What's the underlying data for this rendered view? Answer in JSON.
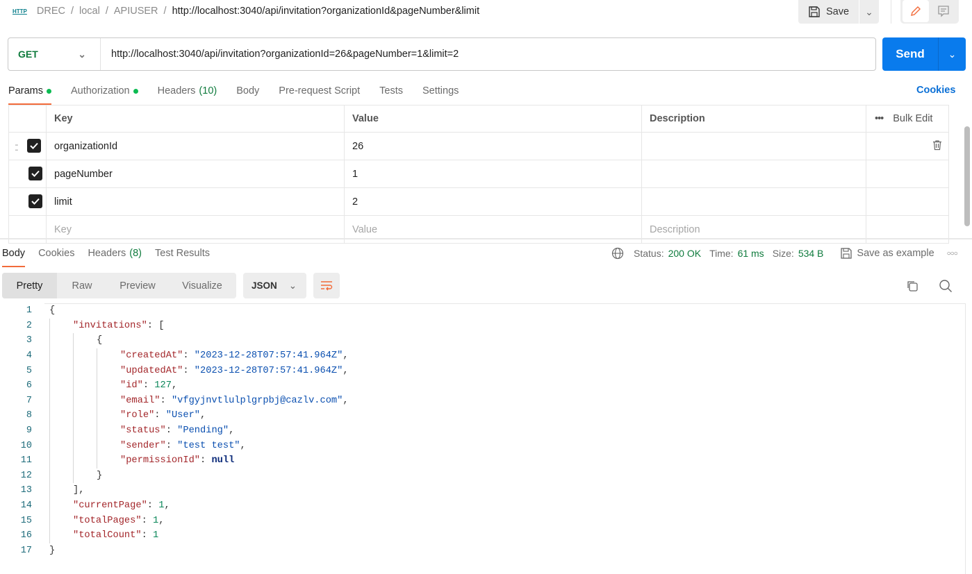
{
  "breadcrumb": {
    "icon": "HTTP",
    "items": [
      "DREC",
      "local",
      "APIUSER"
    ],
    "current": "http://localhost:3040/api/invitation?organizationId&pageNumber&limit"
  },
  "toolbar": {
    "save_label": "Save"
  },
  "request": {
    "method": "GET",
    "url": "http://localhost:3040/api/invitation?organizationId=26&pageNumber=1&limit=2",
    "send_label": "Send"
  },
  "tabs": [
    {
      "label": "Params",
      "dot": true
    },
    {
      "label": "Authorization",
      "dot": true
    },
    {
      "label": "Headers",
      "count": "(10)"
    },
    {
      "label": "Body"
    },
    {
      "label": "Pre-request Script"
    },
    {
      "label": "Tests"
    },
    {
      "label": "Settings"
    }
  ],
  "cookies_link": "Cookies",
  "params": {
    "headers": {
      "key": "Key",
      "value": "Value",
      "description": "Description",
      "bulk_edit": "Bulk Edit"
    },
    "rows": [
      {
        "key": "organizationId",
        "value": "26",
        "checked": true
      },
      {
        "key": "pageNumber",
        "value": "1",
        "checked": true
      },
      {
        "key": "limit",
        "value": "2",
        "checked": true
      }
    ],
    "placeholders": {
      "key": "Key",
      "value": "Value",
      "description": "Description"
    }
  },
  "response": {
    "tabs": [
      {
        "label": "Body"
      },
      {
        "label": "Cookies"
      },
      {
        "label": "Headers",
        "count": "(8)"
      },
      {
        "label": "Test Results"
      }
    ],
    "status_label": "Status:",
    "status": "200 OK",
    "time_label": "Time:",
    "time": "61 ms",
    "size_label": "Size:",
    "size": "534 B",
    "save_example": "Save as example",
    "views": [
      "Pretty",
      "Raw",
      "Preview",
      "Visualize"
    ],
    "format": "JSON",
    "lines": [
      {
        "i": 0,
        "t": [
          [
            "p",
            "{"
          ]
        ]
      },
      {
        "i": 1,
        "t": [
          [
            "k",
            "\"invitations\""
          ],
          [
            "p",
            ": ["
          ]
        ]
      },
      {
        "i": 2,
        "t": [
          [
            "p",
            "{"
          ]
        ]
      },
      {
        "i": 3,
        "t": [
          [
            "k",
            "\"createdAt\""
          ],
          [
            "p",
            ": "
          ],
          [
            "s",
            "\"2023-12-28T07:57:41.964Z\""
          ],
          [
            "p",
            ","
          ]
        ]
      },
      {
        "i": 3,
        "t": [
          [
            "k",
            "\"updatedAt\""
          ],
          [
            "p",
            ": "
          ],
          [
            "s",
            "\"2023-12-28T07:57:41.964Z\""
          ],
          [
            "p",
            ","
          ]
        ]
      },
      {
        "i": 3,
        "t": [
          [
            "k",
            "\"id\""
          ],
          [
            "p",
            ": "
          ],
          [
            "n",
            "127"
          ],
          [
            "p",
            ","
          ]
        ]
      },
      {
        "i": 3,
        "t": [
          [
            "k",
            "\"email\""
          ],
          [
            "p",
            ": "
          ],
          [
            "s",
            "\"vfgyjnvtlulplgrpbj@cazlv.com\""
          ],
          [
            "p",
            ","
          ]
        ]
      },
      {
        "i": 3,
        "t": [
          [
            "k",
            "\"role\""
          ],
          [
            "p",
            ": "
          ],
          [
            "s",
            "\"User\""
          ],
          [
            "p",
            ","
          ]
        ]
      },
      {
        "i": 3,
        "t": [
          [
            "k",
            "\"status\""
          ],
          [
            "p",
            ": "
          ],
          [
            "s",
            "\"Pending\""
          ],
          [
            "p",
            ","
          ]
        ]
      },
      {
        "i": 3,
        "t": [
          [
            "k",
            "\"sender\""
          ],
          [
            "p",
            ": "
          ],
          [
            "s",
            "\"test test\""
          ],
          [
            "p",
            ","
          ]
        ]
      },
      {
        "i": 3,
        "t": [
          [
            "k",
            "\"permissionId\""
          ],
          [
            "p",
            ": "
          ],
          [
            "nl",
            "null"
          ]
        ]
      },
      {
        "i": 2,
        "t": [
          [
            "p",
            "}"
          ]
        ]
      },
      {
        "i": 1,
        "t": [
          [
            "p",
            "],"
          ]
        ]
      },
      {
        "i": 1,
        "t": [
          [
            "k",
            "\"currentPage\""
          ],
          [
            "p",
            ": "
          ],
          [
            "n",
            "1"
          ],
          [
            "p",
            ","
          ]
        ]
      },
      {
        "i": 1,
        "t": [
          [
            "k",
            "\"totalPages\""
          ],
          [
            "p",
            ": "
          ],
          [
            "n",
            "1"
          ],
          [
            "p",
            ","
          ]
        ]
      },
      {
        "i": 1,
        "t": [
          [
            "k",
            "\"totalCount\""
          ],
          [
            "p",
            ": "
          ],
          [
            "n",
            "1"
          ]
        ]
      },
      {
        "i": 0,
        "t": [
          [
            "p",
            "}"
          ]
        ]
      }
    ]
  }
}
